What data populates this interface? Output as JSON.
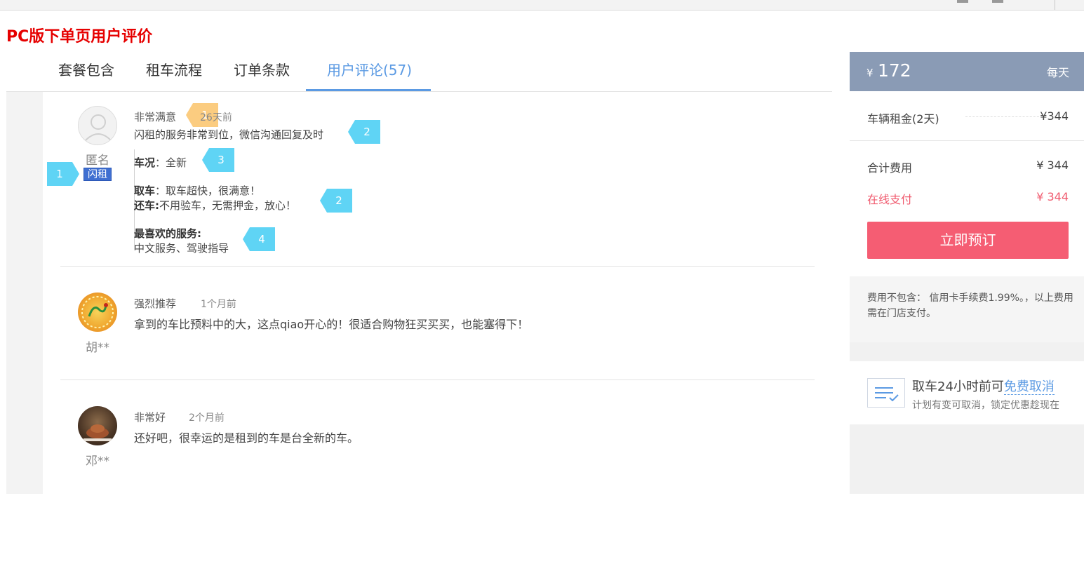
{
  "page_title": "PC版下单页用户评价",
  "tabs": [
    {
      "label": "套餐包含"
    },
    {
      "label": "租车流程"
    },
    {
      "label": "订单条款"
    },
    {
      "label": "用户评论(57)"
    }
  ],
  "reviews": [
    {
      "name": "匿名",
      "tag": "闪租",
      "rating": "非常满意",
      "time": "26天前",
      "text": "闪租的服务非常到位，微信沟通回复及时",
      "condition_label": "车况",
      "condition_value": "全新",
      "pickup_label": "取车",
      "pickup_value": "取车超快，很满意！",
      "return_label": "还车:",
      "return_value": "不用验车，无需押金，放心！",
      "fav_label": "最喜欢的服务:",
      "fav_value": "中文服务、驾驶指导"
    },
    {
      "name": "胡**",
      "rating": "强烈推荐",
      "time": "1个月前",
      "text": "拿到的车比预料中的大，这点qiao开心的！很适合购物狂买买买，也能塞得下！"
    },
    {
      "name": "邓**",
      "rating": "非常好",
      "time": "2个月前",
      "text": "还好吧，很幸运的是租到的车是台全新的车。"
    }
  ],
  "annotations": {
    "name_marker": "1",
    "time_marker": "1",
    "text_marker": "2",
    "condition_marker": "3",
    "pickup_return_marker": "2",
    "fav_marker": "4"
  },
  "price": {
    "currency": "¥",
    "amount": "172",
    "per": "每天",
    "rental_label": "车辆租金(2天)",
    "rental_value": "¥344",
    "total_label": "合计费用",
    "total_value": "¥ 344",
    "online_label": "在线支付",
    "online_value": "¥ 344",
    "book_label": "立即预订",
    "fee_note": "费用不包含： 信用卡手续费1.99%。，以上费用需在门店支付。"
  },
  "cancel": {
    "title_prefix": "取车24小时前可",
    "title_link": "免费取消",
    "subtitle": "计划有变可取消，锁定优惠趁现在"
  },
  "colors": {
    "accent": "#5b9ae3",
    "book_button": "#f55d73",
    "price_header": "#8a9bb5",
    "title_red": "#e60000"
  }
}
